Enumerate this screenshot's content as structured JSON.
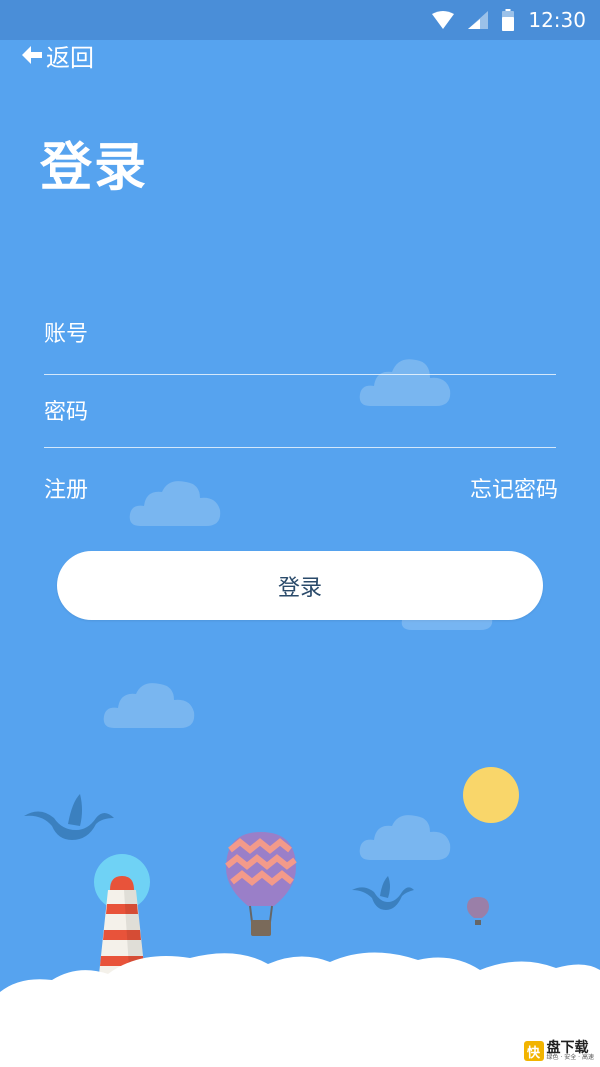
{
  "status_bar": {
    "time": "12:30"
  },
  "nav": {
    "back_label": "返回"
  },
  "page": {
    "title": "登录"
  },
  "form": {
    "account_placeholder": "账号",
    "password_placeholder": "密码",
    "register_label": "注册",
    "forgot_label": "忘记密码",
    "submit_label": "登录"
  },
  "watermark": {
    "glyph": "快",
    "text": "盘下载",
    "subtext": "绿色 · 安全 · 高速"
  },
  "colors": {
    "background": "#56a3ef",
    "status_bar": "#4a8ed8",
    "button_text": "#2a4a6a",
    "sun": "#f9d66a",
    "lighthouse_stripe": "#e8533a"
  }
}
